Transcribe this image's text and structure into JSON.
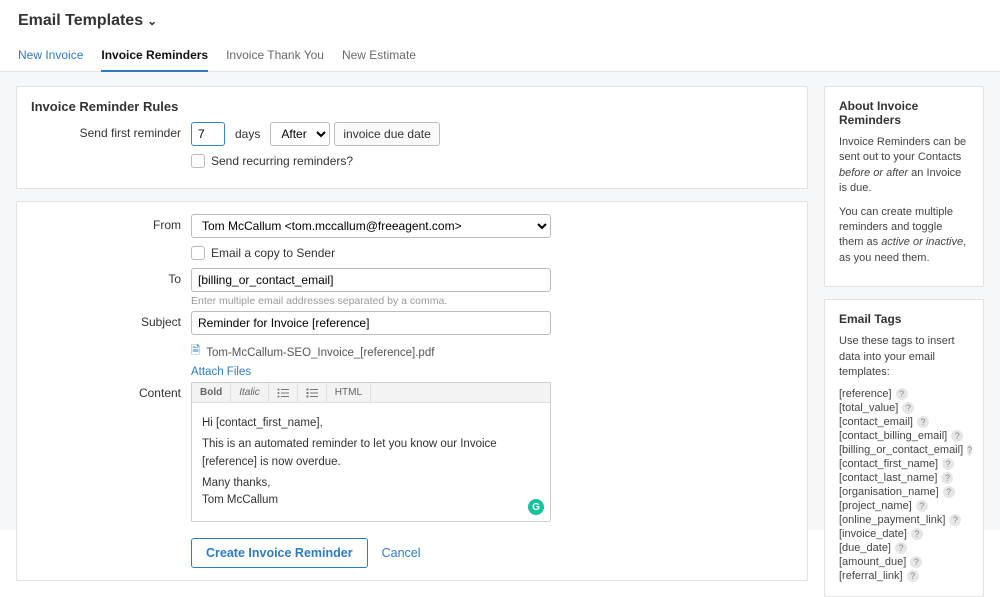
{
  "header": {
    "title": "Email Templates"
  },
  "tabs": [
    {
      "label": "New Invoice",
      "active": false,
      "link": true
    },
    {
      "label": "Invoice Reminders",
      "active": true
    },
    {
      "label": "Invoice Thank You",
      "active": false
    },
    {
      "label": "New Estimate",
      "active": false
    }
  ],
  "rules_panel": {
    "title": "Invoice Reminder Rules",
    "send_first_label": "Send first reminder",
    "days_value": "7",
    "days_unit": "days",
    "direction_value": "After",
    "anchor_text": "invoice due date",
    "recurring_label": "Send recurring reminders?"
  },
  "email_form": {
    "from_label": "From",
    "from_value": "Tom McCallum <tom.mccallum@freeagent.com>",
    "email_copy_label": "Email a copy to Sender",
    "to_label": "To",
    "to_value": "[billing_or_contact_email]",
    "to_help": "Enter multiple email addresses separated by a comma.",
    "subject_label": "Subject",
    "subject_value": "Reminder for Invoice [reference]",
    "attachment_name": "Tom-McCallum-SEO_Invoice_[reference].pdf",
    "attach_files_label": "Attach Files",
    "content_label": "Content",
    "rte_toolbar": {
      "bold": "Bold",
      "italic": "Italic",
      "html": "HTML"
    },
    "content_body_line1": "Hi [contact_first_name],",
    "content_body_line2": "This is an automated reminder to let you know our Invoice [reference] is now overdue.",
    "content_body_line3": "Many thanks,",
    "content_body_line4": "Tom McCallum",
    "submit_label": "Create Invoice Reminder",
    "cancel_label": "Cancel"
  },
  "about_panel": {
    "title": "About Invoice Reminders",
    "p1_a": "Invoice Reminders can be sent out to your Contacts ",
    "p1_em": "before or after",
    "p1_b": " an Invoice is due.",
    "p2_a": "You can create multiple reminders and toggle them as ",
    "p2_em": "active or inactive",
    "p2_b": ", as you need them."
  },
  "tags_panel": {
    "title": "Email Tags",
    "intro": "Use these tags to insert data into your email templates:",
    "tags": [
      "[reference]",
      "[total_value]",
      "[contact_email]",
      "[contact_billing_email]",
      "[billing_or_contact_email]",
      "[contact_first_name]",
      "[contact_last_name]",
      "[organisation_name]",
      "[project_name]",
      "[online_payment_link]",
      "[invoice_date]",
      "[due_date]",
      "[amount_due]",
      "[referral_link]"
    ]
  }
}
